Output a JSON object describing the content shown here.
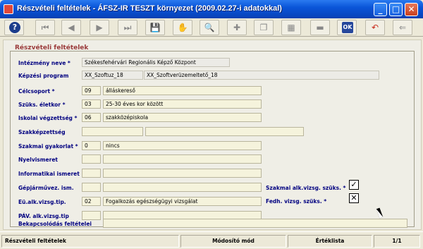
{
  "window": {
    "title": "Részvételi feltételek - ÁFSZ-IR TESZT környezet (2009.02.27-i adatokkal)"
  },
  "toolbar": {
    "buttons": [
      {
        "name": "help-button",
        "glyph": "?"
      },
      {
        "name": "first-record-button",
        "glyph": "⏮"
      },
      {
        "name": "prev-record-button",
        "glyph": "◀"
      },
      {
        "name": "next-record-button",
        "glyph": "▶"
      },
      {
        "name": "last-record-button",
        "glyph": "⏭"
      },
      {
        "name": "save-button",
        "glyph": "💾"
      },
      {
        "name": "search-button",
        "glyph": "✋"
      },
      {
        "name": "find-button",
        "glyph": "🔍"
      },
      {
        "name": "insert-button",
        "glyph": "✚"
      },
      {
        "name": "copy-button",
        "glyph": "❐"
      },
      {
        "name": "grid-button",
        "glyph": "▦"
      },
      {
        "name": "delete-row-button",
        "glyph": "▬"
      },
      {
        "name": "ok-button",
        "glyph": "OK"
      },
      {
        "name": "undo-button",
        "glyph": "↶"
      },
      {
        "name": "exit-button",
        "glyph": "⇐"
      }
    ]
  },
  "form": {
    "section_title": "Részvételi feltételek",
    "rows": {
      "intezmeny": {
        "label": "Intézmény neve",
        "req": " *",
        "value": "Székesfehérvári Regionális Képző Központ"
      },
      "kepzesi": {
        "label": "Képzési program",
        "req": "",
        "code": "XX_Szoftuz_18",
        "value": "XX_Szoftverüzemeltető_18"
      },
      "celcsoport": {
        "label": "Célcsoport",
        "req": " *",
        "code": "09",
        "value": "álláskereső"
      },
      "eletkor": {
        "label": "Szüks. életkor",
        "req": " *",
        "code": "03",
        "value": "25-30 éves kor között"
      },
      "vegzettseg": {
        "label": "Iskolai végzettség",
        "req": " *",
        "code": "06",
        "value": "szakközépiskola"
      },
      "szakkepzettseg": {
        "label": "Szakképzettség",
        "req": "",
        "code": "",
        "value": ""
      },
      "gyakorlat": {
        "label": "Szakmai gyakorlat",
        "req": " *",
        "code": "0",
        "value": "nincs"
      },
      "nyelvismeret": {
        "label": "Nyelvismeret",
        "req": "",
        "code": "",
        "value": ""
      },
      "informatikai": {
        "label": "Informatikai ismeret",
        "req": "",
        "code": "",
        "value": ""
      },
      "gepjarmu": {
        "label": "Gépjárművez. ism.",
        "req": "",
        "code": "",
        "value": ""
      },
      "eualk": {
        "label": "Eü.alk.vizsg.tip.",
        "req": "",
        "code": "02",
        "value": "Fogalkozás egészségügyi vizsgálat"
      },
      "pav": {
        "label": "PÁV. alk.vizsg.tip",
        "req": "",
        "code": "",
        "value": ""
      },
      "bekapcsolodas": {
        "label": "Bekapcsolódás feltételei",
        "req": "",
        "value": ""
      }
    },
    "checks": {
      "szakmai": {
        "label": "Szakmai alk.vizsg. szüks. *",
        "mark": "✓"
      },
      "fedh": {
        "label": "Fedh. vizsg. szüks. *",
        "mark": "✕"
      }
    }
  },
  "status": {
    "title": "Részvételi feltételek",
    "mode": "Módosító mód",
    "list": "Értéklista",
    "page": "1/1"
  }
}
